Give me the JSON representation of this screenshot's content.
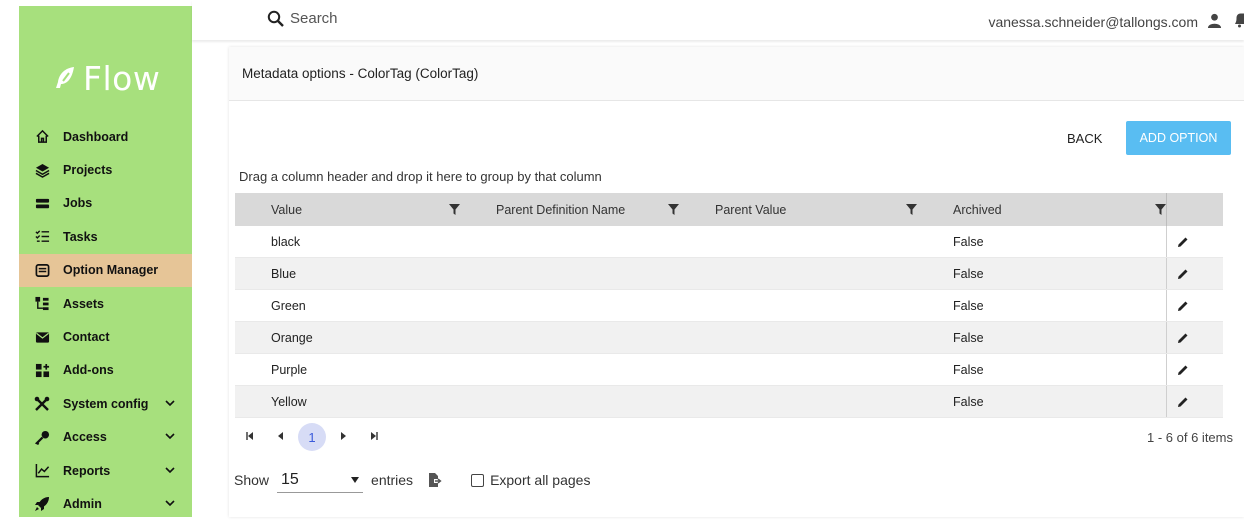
{
  "app": {
    "logo_text": "Flow"
  },
  "search": {
    "placeholder": "Search"
  },
  "user": {
    "email": "vanessa.schneider@tallongs.com"
  },
  "sidebar": {
    "items": [
      {
        "label": "Dashboard",
        "icon": "home-icon"
      },
      {
        "label": "Projects",
        "icon": "layers-icon"
      },
      {
        "label": "Jobs",
        "icon": "jobs-icon"
      },
      {
        "label": "Tasks",
        "icon": "checklist-icon"
      },
      {
        "label": "Option Manager",
        "icon": "option-manager-icon",
        "active": true
      },
      {
        "label": "Assets",
        "icon": "assets-icon"
      },
      {
        "label": "Contact",
        "icon": "mail-icon"
      },
      {
        "label": "Add-ons",
        "icon": "addons-icon"
      },
      {
        "label": "System config",
        "icon": "tools-icon",
        "expandable": true
      },
      {
        "label": "Access",
        "icon": "key-icon",
        "expandable": true
      },
      {
        "label": "Reports",
        "icon": "chart-icon",
        "expandable": true
      },
      {
        "label": "Admin",
        "icon": "rocket-icon",
        "expandable": true
      }
    ]
  },
  "main": {
    "title": "Metadata options - ColorTag (ColorTag)",
    "back_label": "BACK",
    "add_label": "ADD OPTION",
    "group_hint": "Drag a column header and drop it here to group by that column"
  },
  "grid": {
    "columns": [
      "Value",
      "Parent Definition Name",
      "Parent Value",
      "Archived"
    ],
    "rows": [
      [
        "black",
        "",
        "",
        "False"
      ],
      [
        "Blue",
        "",
        "",
        "False"
      ],
      [
        "Green",
        "",
        "",
        "False"
      ],
      [
        "Orange",
        "",
        "",
        "False"
      ],
      [
        "Purple",
        "",
        "",
        "False"
      ],
      [
        "Yellow",
        "",
        "",
        "False"
      ]
    ]
  },
  "pager": {
    "current_page": "1",
    "info": "1 - 6 of 6 items"
  },
  "footer": {
    "show_label": "Show",
    "page_size": "15",
    "entries_label": "entries",
    "export_all_label": "Export all pages"
  },
  "colors": {
    "sidebar": "#a7e07d",
    "active_item": "#e6c597",
    "accent": "#59bdf2",
    "header_row": "#d9d9d9"
  }
}
